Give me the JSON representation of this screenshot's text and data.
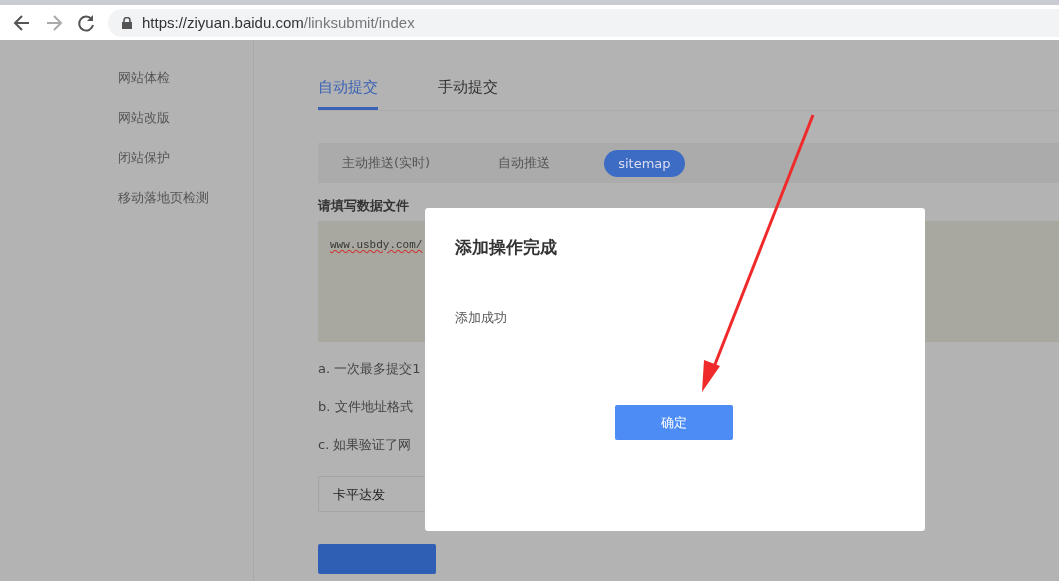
{
  "browser": {
    "url_host": "https://ziyuan.baidu.com",
    "url_path": "/linksubmit/index"
  },
  "sidebar": {
    "items": [
      {
        "label": "网站体检"
      },
      {
        "label": "网站改版"
      },
      {
        "label": "闭站保护"
      },
      {
        "label": "移动落地页检测"
      }
    ]
  },
  "tabs": [
    {
      "label": "自动提交",
      "selected": true
    },
    {
      "label": "手动提交",
      "selected": false
    }
  ],
  "subtabs": [
    {
      "label": "主动推送(实时)",
      "selected": false
    },
    {
      "label": "自动推送",
      "selected": false
    },
    {
      "label": "sitemap",
      "selected": true
    }
  ],
  "form": {
    "label": "请填写数据文件",
    "textarea_value": "www.usbdy.com/",
    "notes": [
      "a. 一次最多提交1",
      "b. 文件地址格式",
      "c. 如果验证了网"
    ],
    "input_value": "卡平达发"
  },
  "dialog": {
    "title": "添加操作完成",
    "message": "添加成功",
    "button": "确定"
  }
}
